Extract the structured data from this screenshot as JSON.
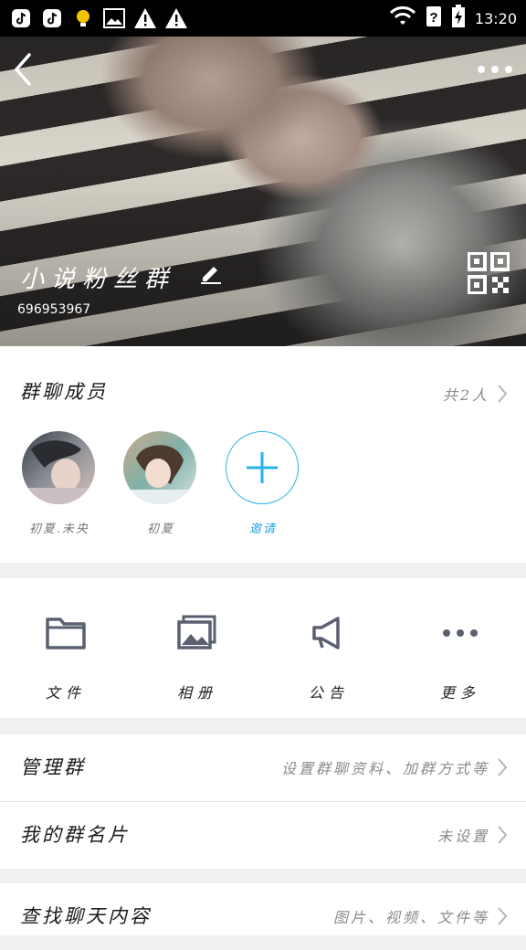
{
  "status_bar": {
    "time": "13:20",
    "left_icons": [
      "tiktok-icon",
      "tiktok-icon",
      "lightbulb-icon",
      "image-icon",
      "warning-icon",
      "warning-icon"
    ],
    "right_icons": [
      "wifi-icon",
      "unknown-sim-icon",
      "battery-charging-icon"
    ]
  },
  "header": {
    "group_name": "小说粉丝群",
    "group_id": "696953967"
  },
  "members": {
    "title": "群聊成员",
    "count_label": "共2人",
    "items": [
      {
        "name": "初夏.未央"
      },
      {
        "name": "初夏"
      }
    ],
    "invite_label": "邀请"
  },
  "tools": [
    {
      "label": "文件",
      "icon": "folder-icon"
    },
    {
      "label": "相册",
      "icon": "photo-album-icon"
    },
    {
      "label": "公告",
      "icon": "megaphone-icon"
    },
    {
      "label": "更多",
      "icon": "more-dots-icon"
    }
  ],
  "settings": [
    {
      "title": "管理群",
      "value": "设置群聊资料、加群方式等"
    },
    {
      "title": "我的群名片",
      "value": "未设置"
    },
    {
      "title": "查找聊天内容",
      "value": "图片、视频、文件等"
    }
  ],
  "colors": {
    "accent": "#2ab1e6",
    "icon_gray": "#5a6070"
  }
}
